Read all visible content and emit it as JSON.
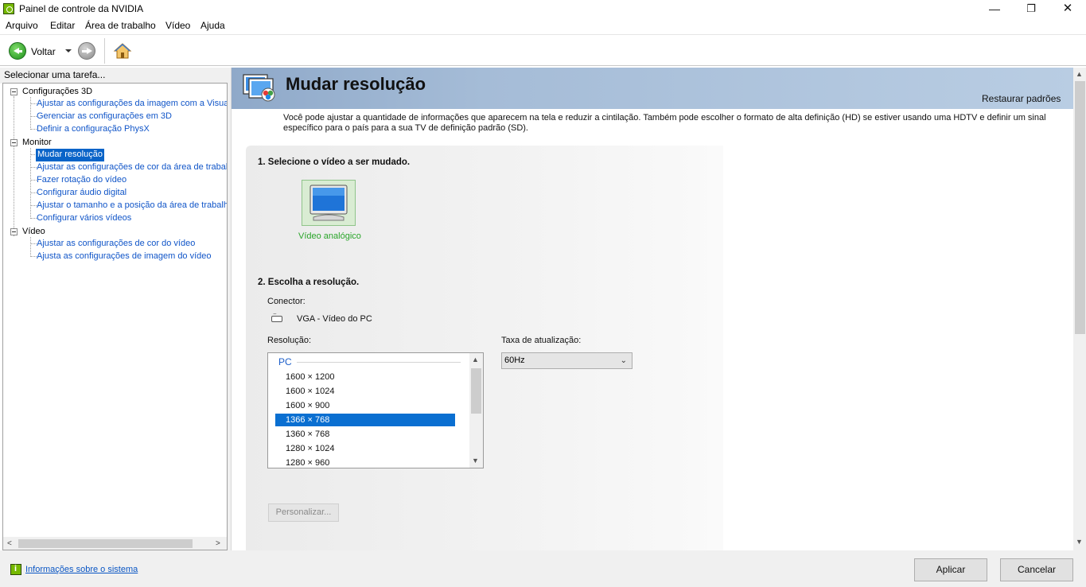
{
  "window": {
    "title": "Painel de controle da NVIDIA",
    "minimize": "—",
    "maximize": "❐",
    "close": "✕"
  },
  "menu": [
    "Arquivo",
    "Editar",
    "Área de trabalho",
    "Vídeo",
    "Ajuda"
  ],
  "toolbar": {
    "back_label": "Voltar"
  },
  "left": {
    "header": "Selecionar uma tarefa...",
    "tree": [
      {
        "label": "Configurações 3D",
        "type": "category"
      },
      {
        "label": "Ajustar as configurações da imagem com a Visualiz",
        "type": "link"
      },
      {
        "label": "Gerenciar as configurações em 3D",
        "type": "link"
      },
      {
        "label": "Definir a configuração PhysX",
        "type": "link"
      },
      {
        "label": "Monitor",
        "type": "category"
      },
      {
        "label": "Mudar resolução",
        "type": "link",
        "selected": true
      },
      {
        "label": "Ajustar as configurações de cor da área de trabalh",
        "type": "link"
      },
      {
        "label": "Fazer rotação do vídeo",
        "type": "link"
      },
      {
        "label": "Configurar áudio digital",
        "type": "link"
      },
      {
        "label": "Ajustar o tamanho e a posição da área de trabalho",
        "type": "link"
      },
      {
        "label": "Configurar vários vídeos",
        "type": "link"
      },
      {
        "label": "Vídeo",
        "type": "category"
      },
      {
        "label": "Ajustar as configurações de cor do vídeo",
        "type": "link"
      },
      {
        "label": "Ajusta as configurações de imagem do vídeo",
        "type": "link"
      }
    ]
  },
  "main": {
    "title": "Mudar resolução",
    "restore_defaults": "Restaurar padrões",
    "description": "Você pode ajustar a quantidade de informações que aparecem na tela e reduzir  a cintilação. Também pode escolher o formato de alta definição (HD) se estiver usando uma HDTV e definir um sinal específico para o país para a sua TV de definição padrão (SD).",
    "step1": "1. Selecione o vídeo a ser mudado.",
    "display_name": "Vídeo analógico",
    "step2": "2. Escolha a resolução.",
    "connector_label": "Conector:",
    "connector_value": "VGA - Vídeo do PC",
    "resolution_label": "Resolução:",
    "resolution_group": "PC",
    "resolutions": [
      "1600 × 1200",
      "1600 × 1024",
      "1600 × 900",
      "1366 × 768",
      "1360 × 768",
      "1280 × 1024",
      "1280 × 960"
    ],
    "selected_resolution": "1366 × 768",
    "refresh_label": "Taxa de atualização:",
    "refresh_value": "60Hz",
    "customize_button": "Personalizar..."
  },
  "bottom": {
    "system_info": "Informações sobre o sistema",
    "apply": "Aplicar",
    "cancel": "Cancelar"
  },
  "colors": {
    "accent_green": "#76b900",
    "selection_blue": "#0a6fd1",
    "link_blue": "#1055c8",
    "banner_blue": "#a5bcd7"
  }
}
